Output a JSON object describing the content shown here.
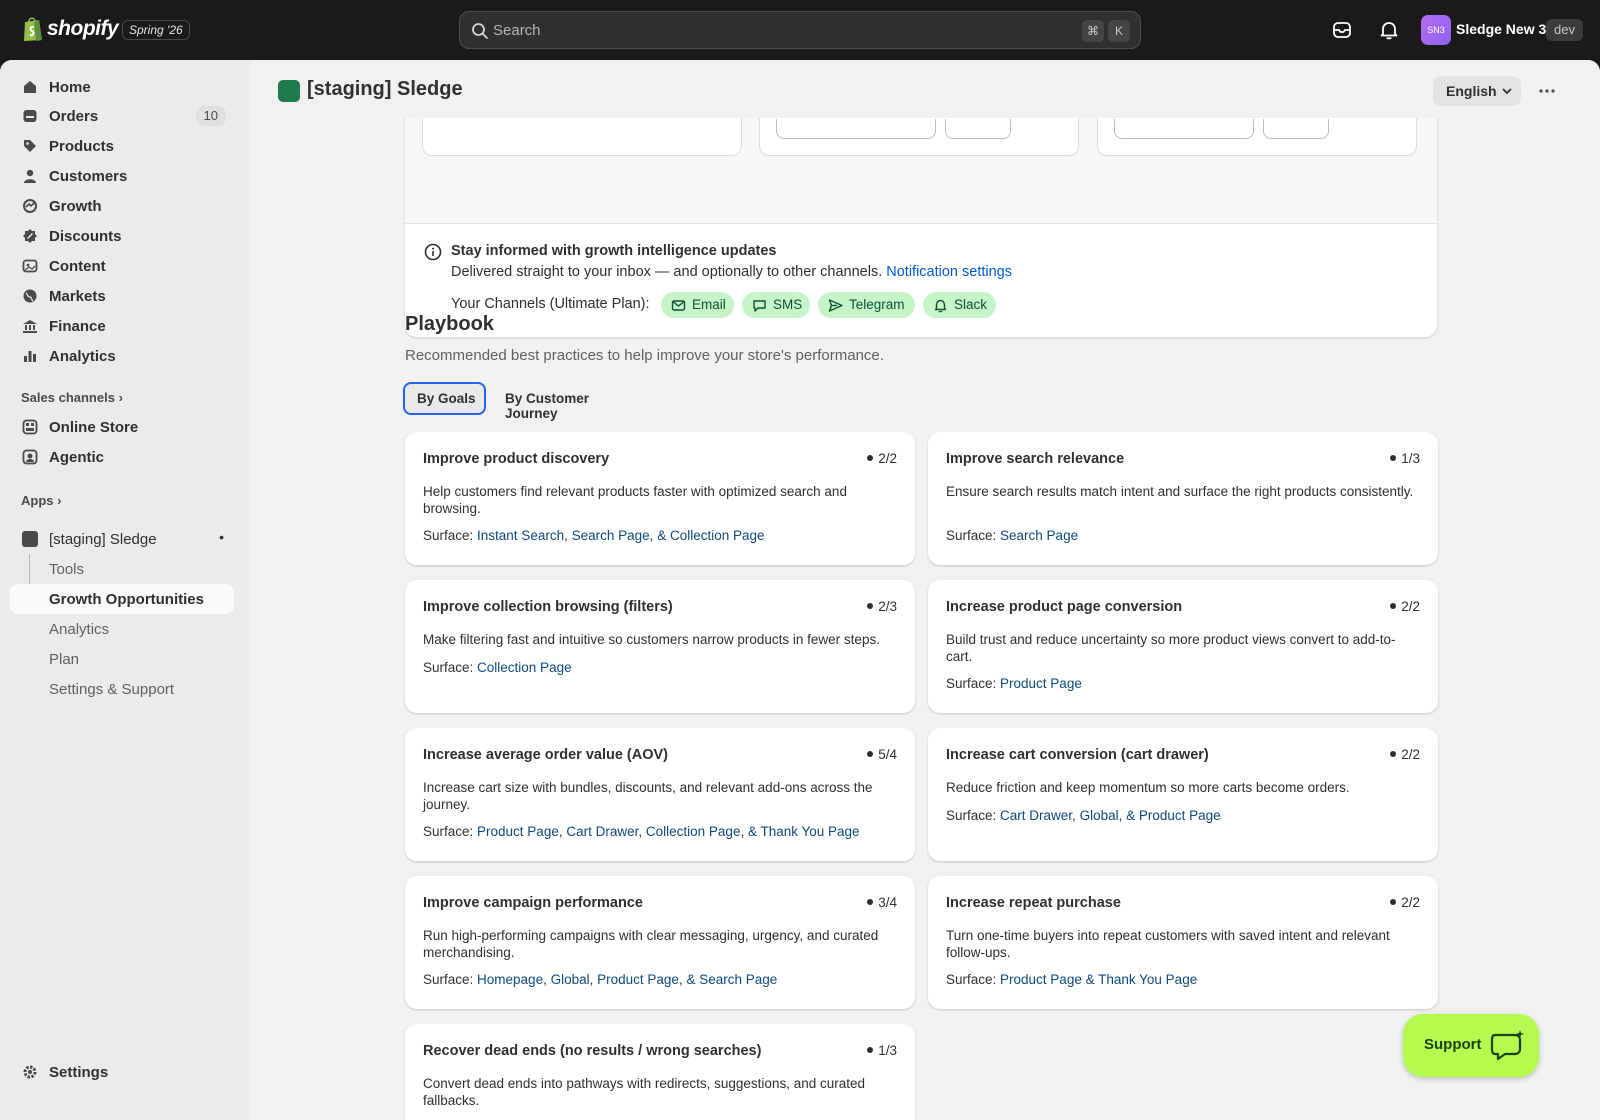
{
  "topbar": {
    "brand": "shopify",
    "edition": "Spring '26",
    "search_placeholder": "Search",
    "shortcut_key1": "⌘",
    "shortcut_key2": "K",
    "avatar_initials": "SN3",
    "store_name": "Sledge New 3",
    "env_badge": "dev"
  },
  "sidebar": {
    "main": [
      {
        "label": "Home",
        "icon": "home-icon"
      },
      {
        "label": "Orders",
        "icon": "orders-icon",
        "badge": "10"
      },
      {
        "label": "Products",
        "icon": "tag-icon"
      },
      {
        "label": "Customers",
        "icon": "person-icon"
      },
      {
        "label": "Growth",
        "icon": "growth-icon"
      },
      {
        "label": "Discounts",
        "icon": "discount-icon"
      },
      {
        "label": "Content",
        "icon": "content-icon"
      },
      {
        "label": "Markets",
        "icon": "globe-icon"
      },
      {
        "label": "Finance",
        "icon": "bank-icon"
      },
      {
        "label": "Analytics",
        "icon": "bar-chart-icon"
      }
    ],
    "sales_channels_label": "Sales channels",
    "channels": [
      {
        "label": "Online Store",
        "icon": "store-icon"
      },
      {
        "label": "Agentic",
        "icon": "agentic-icon"
      }
    ],
    "apps_label": "Apps",
    "app": {
      "label": "[staging] Sledge",
      "dot": "•"
    },
    "app_sub": [
      {
        "label": "Tools"
      },
      {
        "label": "Growth Opportunities"
      },
      {
        "label": "Analytics"
      },
      {
        "label": "Plan"
      },
      {
        "label": "Settings & Support"
      }
    ],
    "settings_label": "Settings"
  },
  "header": {
    "title": "[staging] Sledge",
    "language": "English"
  },
  "info": {
    "title": "Stay informed with growth intelligence updates",
    "desc": "Delivered straight to your inbox — and optionally to other channels.",
    "link": "Notification settings",
    "channels_label": "Your Channels (Ultimate Plan):",
    "channels": [
      "Email",
      "SMS",
      "Telegram",
      "Slack"
    ]
  },
  "playbook": {
    "title": "Playbook",
    "subtitle": "Recommended best practices to help improve your store's performance.",
    "tabs": [
      "By Goals",
      "By Customer Journey"
    ],
    "surface_label": "Surface:",
    "cards": [
      {
        "title": "Improve product discovery",
        "progress": "2/2",
        "desc": "Help customers find relevant products faster with optimized search and browsing.",
        "surfaces": [
          "Instant Search",
          ", ",
          "Search Page",
          ", ",
          "& Collection Page"
        ]
      },
      {
        "title": "Improve search relevance",
        "progress": "1/3",
        "desc": "Ensure search results match intent and surface the right products consistently.",
        "surfaces": [
          "Search Page"
        ]
      },
      {
        "title": "Improve collection browsing (filters)",
        "progress": "2/3",
        "desc": "Make filtering fast and intuitive so customers narrow products in fewer steps.",
        "surfaces": [
          "Collection Page"
        ]
      },
      {
        "title": "Increase product page conversion",
        "progress": "2/2",
        "desc": "Build trust and reduce uncertainty so more product views convert to add-to-cart.",
        "surfaces": [
          "Product Page"
        ]
      },
      {
        "title": "Increase average order value (AOV)",
        "progress": "5/4",
        "desc": "Increase cart size with bundles, discounts, and relevant add-ons across the journey.",
        "surfaces": [
          "Product Page",
          ", ",
          "Cart Drawer",
          ", ",
          "Collection Page",
          ", ",
          "& Thank You Page"
        ]
      },
      {
        "title": "Increase cart conversion (cart drawer)",
        "progress": "2/2",
        "desc": "Reduce friction and keep momentum so more carts become orders.",
        "surfaces": [
          "Cart Drawer",
          ", ",
          "Global",
          ", ",
          "& Product Page"
        ]
      },
      {
        "title": "Improve campaign performance",
        "progress": "3/4",
        "desc": "Run high-performing campaigns with clear messaging, urgency, and curated merchandising.",
        "surfaces": [
          "Homepage",
          ", ",
          "Global",
          ", ",
          "Product Page",
          ", ",
          "& Search Page"
        ]
      },
      {
        "title": "Increase repeat purchase",
        "progress": "2/2",
        "desc": "Turn one-time buyers into repeat customers with saved intent and relevant follow-ups.",
        "surfaces": [
          "Product Page",
          " ",
          "& Thank You Page"
        ]
      },
      {
        "title": "Recover dead ends (no results / wrong searches)",
        "progress": "1/3",
        "desc": "Convert dead ends into pathways with redirects, suggestions, and curated fallbacks.",
        "surfaces": []
      }
    ]
  },
  "support_label": "Support",
  "colors": {
    "accent": "#005bd3",
    "surface_link": "#0f4a7d",
    "chip_bg": "#c6f5c9",
    "support_bg": "#b4fa4f",
    "tab_focus": "#2463eb"
  }
}
